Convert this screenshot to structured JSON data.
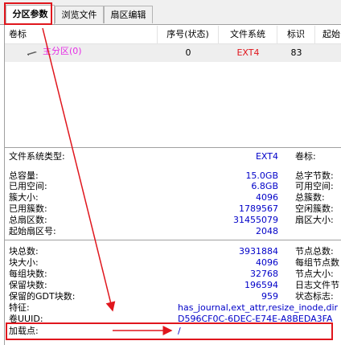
{
  "tabs": [
    {
      "label": "分区参数"
    },
    {
      "label": "浏览文件"
    },
    {
      "label": "扇区编辑"
    }
  ],
  "table": {
    "headers": [
      "卷标",
      "序号(状态)",
      "文件系统",
      "标识",
      "起始"
    ],
    "row": {
      "name": "主分区(0)",
      "index": "0",
      "fs": "EXT4",
      "id": "83"
    }
  },
  "info1": [
    {
      "label": "文件系统类型:",
      "value": "EXT4",
      "rlabel": "卷标:"
    },
    {
      "label": "总容量:",
      "value": "15.0GB",
      "rlabel": "总字节数:"
    },
    {
      "label": "已用空间:",
      "value": "6.8GB",
      "rlabel": "可用空间:"
    },
    {
      "label": "簇大小:",
      "value": "4096",
      "rlabel": "总簇数:"
    },
    {
      "label": "已用簇数:",
      "value": "1789567",
      "rlabel": "空闲簇数:"
    },
    {
      "label": "总扇区数:",
      "value": "31455079",
      "rlabel": "扇区大小:"
    },
    {
      "label": "起始扇区号:",
      "value": "2048",
      "rlabel": ""
    }
  ],
  "info2": [
    {
      "label": "块总数:",
      "value": "3931884",
      "rlabel": "节点总数:"
    },
    {
      "label": "块大小:",
      "value": "4096",
      "rlabel": "每组节点数"
    },
    {
      "label": "每组块数:",
      "value": "32768",
      "rlabel": "节点大小:"
    },
    {
      "label": "保留块数:",
      "value": "196594",
      "rlabel": "日志文件节"
    },
    {
      "label": "保留的GDT块数:",
      "value": "959",
      "rlabel": "状态标志:"
    }
  ],
  "features": {
    "label": "特征:",
    "value": "has_journal,ext_attr,resize_inode,dir"
  },
  "uuid": {
    "label": "卷UUID:",
    "value": "D596CF0C-6DEC-E74E-A8BEDA3FA"
  },
  "mount": {
    "label": "加载点:",
    "value": "/"
  },
  "colors": {
    "highlight": "#e0161d",
    "value": "#0000c8",
    "partition": "#e62ee6"
  }
}
